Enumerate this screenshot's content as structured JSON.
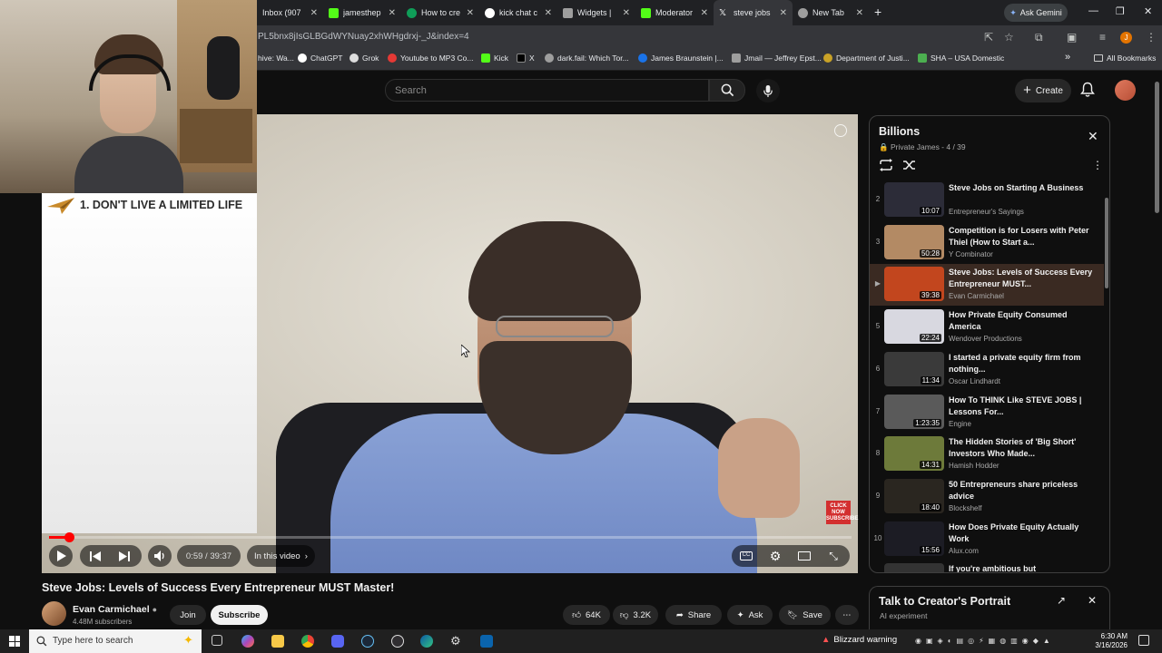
{
  "browser": {
    "tabs": [
      {
        "title": "Inbox (907",
        "color": "#ea4335"
      },
      {
        "title": "jamesthep",
        "color": "#53fc18"
      },
      {
        "title": "How to cre",
        "color": "#0f9d58"
      },
      {
        "title": "kick chat c",
        "color": "#ffffff"
      },
      {
        "title": "Widgets | ",
        "color": "#9e9e9e"
      },
      {
        "title": "Moderator",
        "color": "#53fc18"
      },
      {
        "title": "steve jobs",
        "color": "#ffffff"
      },
      {
        "title": "New Tab",
        "color": "#9e9e9e"
      }
    ],
    "ask_gemini": "Ask Gemini",
    "url": "PL5bnx8jIsGLBGdWYNuay2xhWHgdrxj-_J&index=4",
    "bookmarks": [
      {
        "label": "hive: Wa...",
        "color": "#9e9e9e"
      },
      {
        "label": "ChatGPT",
        "color": "#ffffff"
      },
      {
        "label": "Grok",
        "color": "#ffffff"
      },
      {
        "label": "Youtube to MP3 Co...",
        "color": "#e53935"
      },
      {
        "label": "Kick",
        "color": "#53fc18"
      },
      {
        "label": "X",
        "color": "#ffffff"
      },
      {
        "label": "dark.fail: Which Tor...",
        "color": "#9e9e9e"
      },
      {
        "label": "James Braunstein |...",
        "color": "#1a73e8"
      },
      {
        "label": "Jmail — Jeffrey Epst...",
        "color": "#9e9e9e"
      },
      {
        "label": "Department of Justi...",
        "color": "#c9a227"
      },
      {
        "label": "SHA – USA Domestic",
        "color": "#4caf50"
      }
    ],
    "all_bookmarks": "All Bookmarks",
    "profile_initial": "J"
  },
  "youtube": {
    "search_placeholder": "Search",
    "create_label": "Create",
    "slide_title": "1. DON'T LIVE A LIMITED LIFE",
    "player": {
      "time": "0:59 / 39:37",
      "progress": 0.025,
      "in_this_video": "In this video",
      "click_now": "CLICK NOW SUBSCRIBE"
    },
    "video_title": "Steve Jobs: Levels of Success Every Entrepreneur MUST Master!",
    "channel": {
      "name": "Evan Carmichael",
      "subscribers": "4.48M subscribers"
    },
    "join": "Join",
    "subscribe": "Subscribe",
    "likes": "64K",
    "dislikes": "3.2K",
    "share": "Share",
    "ask": "Ask",
    "save": "Save",
    "playlist": {
      "title": "Billions",
      "subtitle": "Private James - 4 / 39",
      "items": [
        {
          "index": "2",
          "title": "Steve Jobs on Starting A Business",
          "channel": "Entrepreneur's Sayings",
          "duration": "10:07",
          "thumb": "#2c2c38"
        },
        {
          "index": "3",
          "title": "Competition is for Losers with Peter Thiel (How to Start a...",
          "channel": "Y Combinator",
          "duration": "50:28",
          "thumb": "#b38a64"
        },
        {
          "index": "▶",
          "title": "Steve Jobs: Levels of Success Every Entrepreneur MUST...",
          "channel": "Evan Carmichael",
          "duration": "39:38",
          "thumb": "#c2461e",
          "active": true
        },
        {
          "index": "5",
          "title": "How Private Equity Consumed America",
          "channel": "Wendover Productions",
          "duration": "22:24",
          "thumb": "#d8d8e0"
        },
        {
          "index": "6",
          "title": "I started a private equity firm from nothing...",
          "channel": "Oscar Lindhardt",
          "duration": "11:34",
          "thumb": "#3a3a3a"
        },
        {
          "index": "7",
          "title": "How To THINK Like STEVE JOBS | Lessons For...",
          "channel": "Engine",
          "duration": "1:23:35",
          "thumb": "#5a5a5a"
        },
        {
          "index": "8",
          "title": "The Hidden Stories of 'Big Short' Investors Who Made...",
          "channel": "Hamish Hodder",
          "duration": "14:31",
          "thumb": "#6d7a3a"
        },
        {
          "index": "9",
          "title": "50 Entrepreneurs share priceless advice",
          "channel": "Blockshelf",
          "duration": "18:40",
          "thumb": "#2a2620"
        },
        {
          "index": "10",
          "title": "How Does Private Equity Actually Work",
          "channel": "Alux.com",
          "duration": "15:56",
          "thumb": "#1c1c24"
        },
        {
          "index": "",
          "title": "If you're ambitious but",
          "channel": "",
          "duration": "",
          "thumb": "#333"
        }
      ]
    },
    "creator_panel": {
      "title": "Talk to Creator's Portrait",
      "subtitle": "AI experiment"
    }
  },
  "taskbar": {
    "search_placeholder": "Type here to search",
    "weather": "Blizzard warning",
    "time": "6:30 AM",
    "date": "3/16/2026"
  }
}
